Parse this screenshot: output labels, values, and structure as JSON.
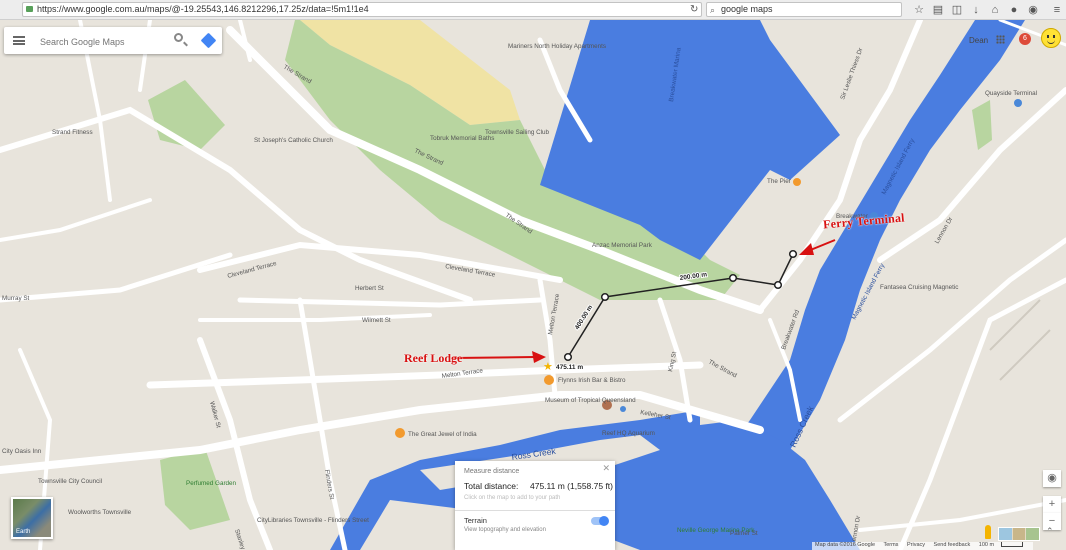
{
  "browser": {
    "url": "https://www.google.com.au/maps/@-19.25543,146.8212296,17.25z/data=!5m1!1e4",
    "search": "google maps"
  },
  "search": {
    "placeholder": "Search Google Maps"
  },
  "account": {
    "name": "Dean",
    "notifications": "6"
  },
  "places": {
    "mariners": "Mariners North Holiday Apartments",
    "marina": "Breakwater Marina",
    "tobruk": "Tobruk Memorial Baths",
    "sailing": "Townsville Sailing Club",
    "church": "St Joseph's Catholic Church",
    "fitness": "Strand Fitness",
    "pier": "The Pier",
    "breakwater": "Breakwater",
    "quayside": "Quayside Terminal",
    "fantasea": "Fantasea Cruising Magnetic",
    "anzac": "Anzac Memorial Park",
    "flynns": "Flynns Irish Bar & Bistro",
    "museum": "Museum of Tropical Queensland",
    "jewel": "The Great Jewel of India",
    "reefhq": "Reef HQ Aquarium",
    "cityoasis": "City Oasis Inn",
    "council": "Townsville City Council",
    "perfumed": "Perfumed Garden",
    "woolworths": "Woolworths Townsville",
    "library": "CityLibraries Townsville - Flinders Street",
    "neville": "Neville George Marine Park"
  },
  "streets": {
    "strand": "The Strand",
    "cleveland": "Cleveland Terrace",
    "herbert": "Herbert St",
    "wilmett": "Wilmett St",
    "murray": "Murray St",
    "melton": "Melton Terrace",
    "walker": "Walker St",
    "flinders": "Flinders St",
    "stanley": "Stanley St",
    "king": "King St",
    "kelleher": "Kelleher St",
    "breakwaterRd": "Breakwater Rd",
    "lennon": "Lennon Dr",
    "palmer": "Palmer St",
    "rosscreek": "Ross Creek",
    "magnetic": "Magnetic Island Ferry",
    "leslie": "Sir Leslie Thiess Dr"
  },
  "measure": {
    "title": "Measure distance",
    "total_label": "Total distance:",
    "total_value": "475.11 m (1,558.75 ft)",
    "hint": "Click on the map to add to your path",
    "terrain": "Terrain",
    "terrain_sub": "View topography and elevation",
    "seg1": "200.00 m",
    "seg2": "400.00 m",
    "end": "475.11 m"
  },
  "annotations": {
    "ferry": "Ferry Terminal",
    "reef": "Reef Lodge"
  },
  "earth_label": "Earth",
  "footer": {
    "attribution": "Map data ©2016 Google",
    "terms": "Terms",
    "privacy": "Privacy",
    "feedback": "Send feedback",
    "scale": "100 m"
  },
  "colors": {
    "water": "#4a7de0",
    "land": "#e8e4dc",
    "park": "#b8d5a0",
    "road": "#ffffff",
    "route": "#222222",
    "annotation": "#d81111",
    "beach": "#f0e3a4"
  }
}
